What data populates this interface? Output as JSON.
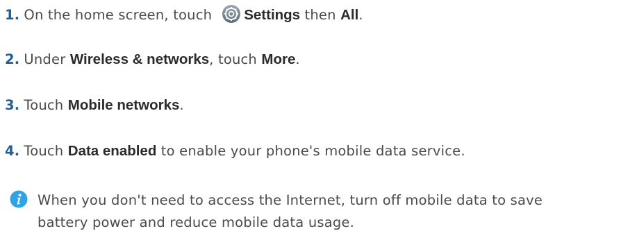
{
  "steps": [
    {
      "num": "1.",
      "t1": "On the home screen, touch",
      "icon": "settings-gear-icon",
      "b1": "Settings",
      "t2": " then ",
      "b2": "All",
      "t3": "."
    },
    {
      "num": "2.",
      "t1": "Under ",
      "b1": "Wireless & networks",
      "t2": ", touch ",
      "b2": "More",
      "t3": "."
    },
    {
      "num": "3.",
      "t1": "Touch ",
      "b1": "Mobile networks",
      "t2": "."
    },
    {
      "num": "4.",
      "t1": "Touch ",
      "b1": "Data enabled",
      "t2": " to enable your phone's mobile data service."
    }
  ],
  "note": {
    "icon": "info-icon",
    "line1": "When you don't need to access the Internet, turn off mobile data to save",
    "line2": "battery power and reduce mobile data usage."
  },
  "colors": {
    "step_number": "#1f5e97",
    "info_icon": "#2fa3e6",
    "body_text": "#4a4a4a"
  }
}
